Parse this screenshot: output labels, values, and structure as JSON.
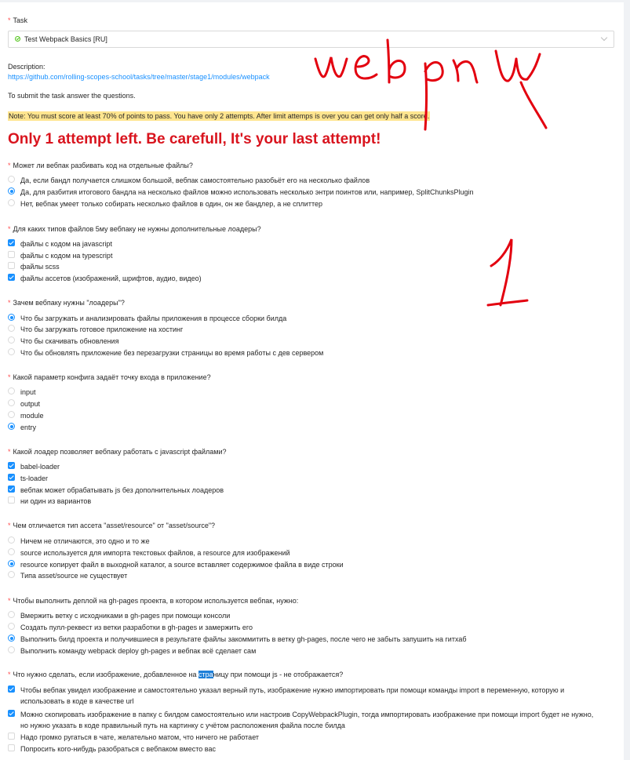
{
  "task": {
    "label": "Task",
    "selected": "Test Webpack Basics [RU]"
  },
  "description": {
    "label": "Description:",
    "link": "https://github.com/rolling-scopes-school/tasks/tree/master/stage1/modules/webpack"
  },
  "instruction": "To submit the task answer the questions.",
  "note": "Note: You must score at least 70% of points to pass. You have only 2 attempts. After limit attemps is over you can get only half a score.",
  "warning": "Only 1 attempt left. Be carefull, It's your last attempt!",
  "handwriting": {
    "word": "webpack",
    "number": "1",
    "color": "#e3000f"
  },
  "questions": [
    {
      "text": "Может ли вебпак разбивать код на отдельные файлы?",
      "type": "radio",
      "options": [
        {
          "text": "Да, если бандл получается слишком большой, вебпак самостоятельно разобьёт его на несколько файлов",
          "checked": false
        },
        {
          "text": "Да, для разбития итогового бандла на несколько файлов можно использовать несколько энтри поинтов или, например, SplitChunksPlugin",
          "checked": true
        },
        {
          "text": "Нет, вебпак умеет только собирать несколько файлов в один, он же бандлер, а не сплиттер",
          "checked": false
        }
      ]
    },
    {
      "text": "Для каких типов файлов 5му вебпаку не нужны дополнительные лоадеры?",
      "type": "checkbox",
      "options": [
        {
          "text": "файлы с кодом на javascript",
          "checked": true
        },
        {
          "text": "файлы с кодом на typescript",
          "checked": false
        },
        {
          "text": "файлы scss",
          "checked": false
        },
        {
          "text": "файлы ассетов (изображений, шрифтов, аудио, видео)",
          "checked": true
        }
      ]
    },
    {
      "text": "Зачем вебпаку нужны \"лоадеры\"?",
      "type": "radio",
      "options": [
        {
          "text": "Что бы загружать и анализировать файлы приложения в процессе сборки билда",
          "checked": true
        },
        {
          "text": "Что бы загружать готовое приложение на хостинг",
          "checked": false
        },
        {
          "text": "Что бы скачивать обновления",
          "checked": false
        },
        {
          "text": "Что бы обновлять приложение без перезагрузки страницы во время работы с дев сервером",
          "checked": false
        }
      ]
    },
    {
      "text": "Какой параметр конфига задаёт точку входа в приложение?",
      "type": "radio",
      "options": [
        {
          "text": "input",
          "checked": false
        },
        {
          "text": "output",
          "checked": false
        },
        {
          "text": "module",
          "checked": false
        },
        {
          "text": "entry",
          "checked": true
        }
      ]
    },
    {
      "text": "Какой лоадер позволяет вебпаку работать с javascript файлами?",
      "type": "checkbox",
      "options": [
        {
          "text": "babel-loader",
          "checked": true
        },
        {
          "text": "ts-loader",
          "checked": true
        },
        {
          "text": "вебпак может обрабатывать js без дополнительных лоадеров",
          "checked": true
        },
        {
          "text": "ни один из вариантов",
          "checked": false
        }
      ]
    },
    {
      "text": "Чем отличается тип ассета \"asset/resource\" от \"asset/source\"?",
      "type": "radio",
      "options": [
        {
          "text": "Ничем не отличаются, это одно и то же",
          "checked": false
        },
        {
          "text": "source используется для импорта текстовых файлов, а resource для изображений",
          "checked": false
        },
        {
          "text": "resource копирует файл в выходной каталог, а source вставляет содержимое файла в виде строки",
          "checked": true
        },
        {
          "text": "Типа asset/source не существует",
          "checked": false
        }
      ]
    },
    {
      "text": "Чтобы выполнить деплой на gh-pages проекта, в котором используется вебпак, нужно:",
      "type": "radio",
      "options": [
        {
          "text": "Вмержить ветку с исходниками в gh-pages при помощи консоли",
          "checked": false
        },
        {
          "text": "Создать пулл-реквест из ветки разработки в gh-pages и замержить его",
          "checked": false
        },
        {
          "text": "Выполнить билд проекта и получившиеся в результате файлы закоммитить в ветку gh-pages, после чего не забыть запушить на гитхаб",
          "checked": true
        },
        {
          "text": "Выполнить команду webpack deploy gh-pages и вебпак всё сделает сам",
          "checked": false
        }
      ]
    },
    {
      "text_before": "Что нужно сделать, если изображение, добавленное на ",
      "text_highlight": "стра",
      "text_after": "ницу при помощи js - не отображается?",
      "type": "checkbox",
      "options": [
        {
          "text": "Чтобы вебпак увидел изображение и самостоятельно указал верный путь, изображение нужно импортировать при помощи команды import в переменную, которую и использовать в коде в качестве url",
          "checked": true
        },
        {
          "text": "Можно скопировать изображение в папку с билдом самостоятельно или настроив CopyWebpackPlugin, тогда импортировать изображение при помощи import будет не нужно, но нужно указать в коде правильный путь на картинку с учётом расположения файла после билда",
          "checked": true
        },
        {
          "text": "Надо громко ругаться в чате, желательно матом, что ничего не работает",
          "checked": false
        },
        {
          "text": "Попросить кого-нибудь разобраться с вебпаком вместо вас",
          "checked": false
        }
      ]
    }
  ]
}
